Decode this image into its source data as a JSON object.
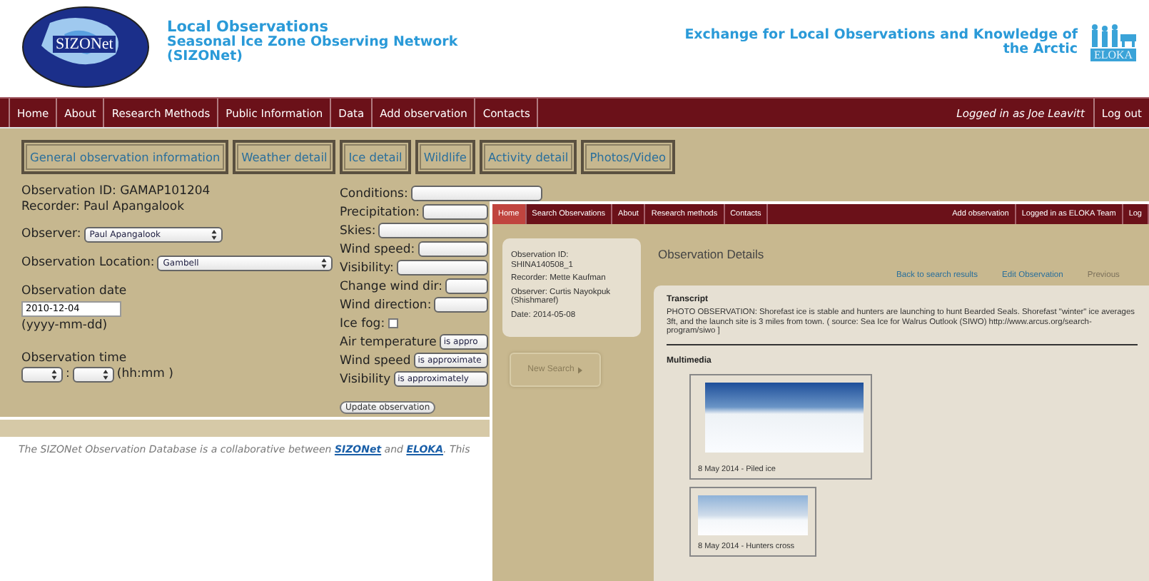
{
  "header": {
    "logo_text": "SIZONet",
    "title": "Local Observations",
    "subtitle_lines": [
      "Seasonal Ice Zone Observing Network",
      "(SIZONet)"
    ],
    "partner_lines": [
      "Exchange for Local Observations and Knowledge of",
      "the Arctic"
    ],
    "partner_logo_text": "ELOKA"
  },
  "nav": {
    "items": [
      "Home",
      "About",
      "Research Methods",
      "Public Information",
      "Data",
      "Add observation",
      "Contacts"
    ],
    "user": "Logged in as Joe Leavitt",
    "logout": "Log out"
  },
  "tabs": [
    "General observation information",
    "Weather detail",
    "Ice detail",
    "Wildlife",
    "Activity detail",
    "Photos/Video"
  ],
  "form": {
    "observation_id": "Observation ID: GAMAP101204",
    "recorder": "Recorder: Paul Apangalook",
    "observer": {
      "label": "Observer:",
      "value": "Paul Apangalook"
    },
    "location": {
      "label": "Observation Location:",
      "value": "Gambell"
    },
    "date": {
      "label": "Observation date",
      "value": "2010-12-04",
      "hint": "(yyyy-mm-dd)"
    },
    "time": {
      "label": "Observation time",
      "separator": ":",
      "hint": "(hh:mm )"
    }
  },
  "conditions": [
    {
      "kind": "select",
      "label": "Conditions:"
    },
    {
      "kind": "select",
      "label": "Precipitation:"
    },
    {
      "kind": "select",
      "label": "Skies:"
    },
    {
      "kind": "select",
      "label": "Wind speed:"
    },
    {
      "kind": "select",
      "label": "Visibility:"
    },
    {
      "kind": "select",
      "label": "Change wind dir:"
    },
    {
      "kind": "select",
      "label": "Wind direction:"
    },
    {
      "kind": "checkbox",
      "label": "Ice fog:",
      "checked": false
    },
    {
      "kind": "select",
      "label": "Air temperature",
      "value": "is appro"
    },
    {
      "kind": "select",
      "label": "Wind speed",
      "value": "is approximate"
    },
    {
      "kind": "select",
      "label": "Visibility",
      "value": "is approximately"
    }
  ],
  "update_button": "Update observation",
  "footer": {
    "before": "The SIZONet Observation Database is a collaborative between ",
    "link_1": "SIZONet",
    "middle": " and ",
    "link_2": "ELOKA",
    "after": ". This"
  },
  "overlay": {
    "nav": [
      {
        "label": "Home",
        "selected": true
      },
      {
        "label": "Search Observations",
        "selected": false
      },
      {
        "label": "About",
        "selected": false
      },
      {
        "label": "Research methods",
        "selected": false
      },
      {
        "label": "Contacts",
        "selected": false
      }
    ],
    "nav_right": [
      "Add observation",
      "Logged in as ELOKA Team",
      "Log"
    ],
    "summary": [
      "Observation ID: SHINA140508_1",
      "Recorder: Mette Kaufman",
      "Observer: Curtis Nayokpuk (Shishmaref)",
      "Date: 2014-05-08"
    ],
    "new_search": "New Search",
    "heading": "Observation Details",
    "links": [
      {
        "label": "Back to search results",
        "disabled": false
      },
      {
        "label": "Edit Observation",
        "disabled": false
      },
      {
        "label": "Previous",
        "disabled": true
      }
    ],
    "transcript_title": "Transcript",
    "transcript": "PHOTO OBSERVATION: Shorefast ice is stable and hunters are launching to hunt Bearded Seals. Shorefast \"winter\" ice averages 3ft, and the launch site is 3 miles from town. ( source: Sea Ice for Walrus Outlook (SIWO) http://www.arcus.org/search-program/siwo ]",
    "multimedia_title": "Multimedia",
    "media": [
      {
        "kind": "large",
        "caption": "8 May 2014 - Piled ice"
      },
      {
        "kind": "small",
        "caption": "8 May 2014 - Hunters cross"
      }
    ]
  }
}
